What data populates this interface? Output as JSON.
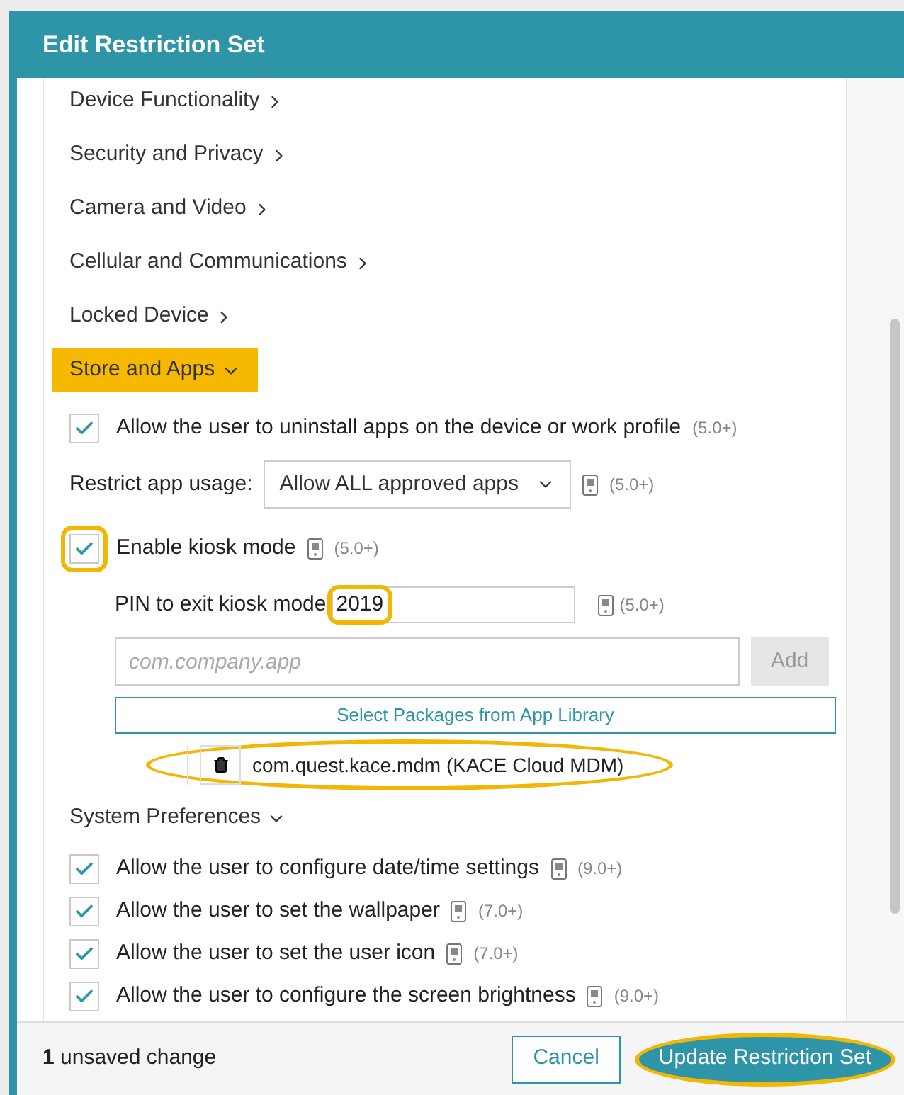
{
  "dialog": {
    "title": "Edit Restriction Set"
  },
  "collapsed_sections": [
    {
      "label": "Device Functionality",
      "expanded": false
    },
    {
      "label": "Security and Privacy",
      "expanded": false
    },
    {
      "label": "Camera and Video",
      "expanded": false
    },
    {
      "label": "Cellular and Communications",
      "expanded": false
    },
    {
      "label": "Locked Device",
      "expanded": false
    }
  ],
  "store_and_apps": {
    "label": "Store and Apps",
    "expanded": true,
    "selected": true,
    "uninstall": {
      "label": "Allow the user to uninstall apps on the device or work profile",
      "version": "(5.0+)",
      "checked": true,
      "device_icon": false
    },
    "restrict": {
      "label": "Restrict app usage:",
      "value": "Allow ALL approved apps",
      "version": "(5.0+)"
    },
    "kiosk": {
      "label": "Enable kiosk mode",
      "version": "(5.0+)",
      "checked": true,
      "device_icon": true,
      "highlighted": true
    },
    "pin": {
      "label": "PIN to exit kiosk mode",
      "value": "2019",
      "version": "(5.0+)",
      "highlighted": true
    },
    "package_input": {
      "placeholder": "com.company.app"
    },
    "add_button": {
      "label": "Add",
      "disabled": true
    },
    "library_button": {
      "label": "Select Packages from App Library"
    },
    "packages": [
      {
        "name": "com.quest.kace.mdm (KACE Cloud MDM)",
        "highlighted": true
      }
    ]
  },
  "system_preferences": {
    "label": "System Preferences",
    "expanded": true,
    "items": [
      {
        "label": "Allow the user to configure date/time settings",
        "version": "(9.0+)",
        "checked": true,
        "device_icon": true
      },
      {
        "label": "Allow the user to set the wallpaper",
        "version": "(7.0+)",
        "checked": true,
        "device_icon": true
      },
      {
        "label": "Allow the user to set the user icon",
        "version": "(7.0+)",
        "checked": true,
        "device_icon": true
      },
      {
        "label": "Allow the user to configure the screen brightness",
        "version": "(9.0+)",
        "checked": true,
        "device_icon": true
      }
    ]
  },
  "footer": {
    "status": "**1** unsaved change",
    "cancel": "Cancel",
    "submit": {
      "label": "Update Restriction Set",
      "highlighted": true
    }
  }
}
